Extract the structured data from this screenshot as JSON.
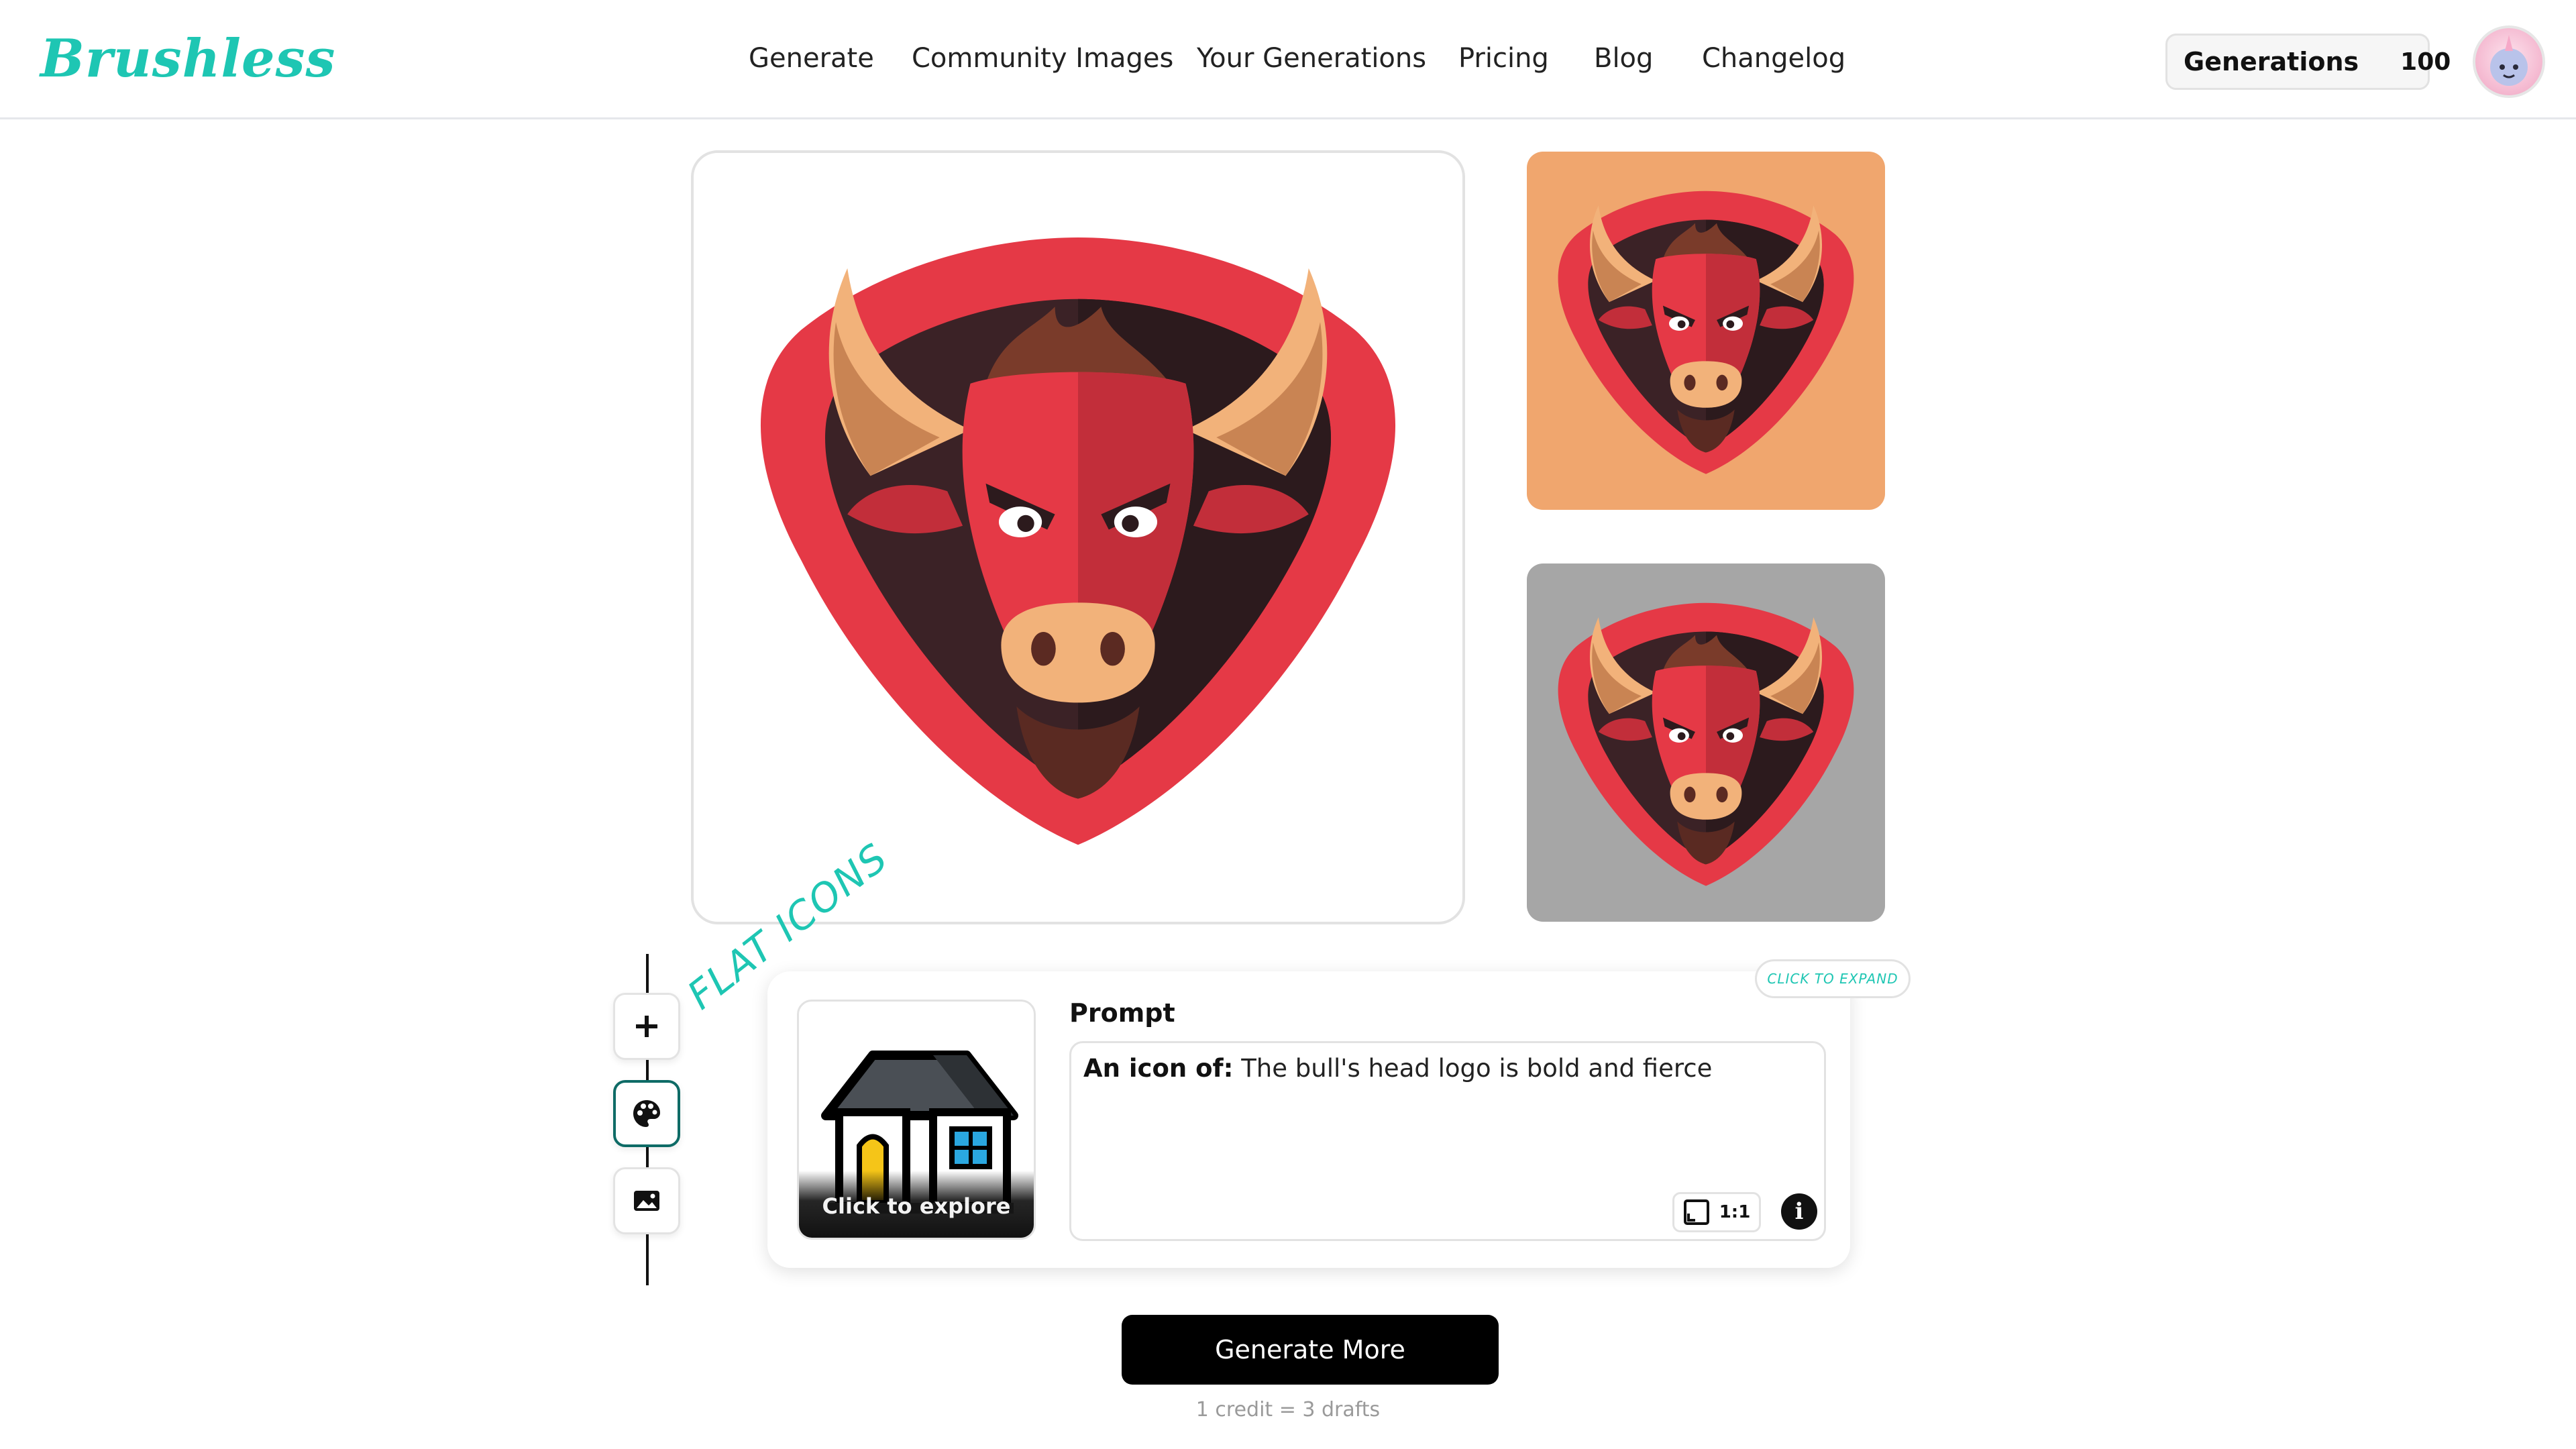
{
  "header": {
    "logo": "Brushless",
    "nav": [
      {
        "label": "Generate"
      },
      {
        "label": "Community Images"
      },
      {
        "label": "Your Generations"
      },
      {
        "label": "Pricing"
      },
      {
        "label": "Blog"
      },
      {
        "label": "Changelog"
      }
    ],
    "generations_label": "Generations",
    "generations_count": "100"
  },
  "results": {
    "main_image_icon": "bull-head-logo",
    "thumbnails": [
      {
        "icon": "bull-head-logo",
        "background": "#f0a66e"
      },
      {
        "icon": "bull-head-logo",
        "background": "#a6a6a6"
      }
    ]
  },
  "tools": [
    {
      "icon": "plus-icon"
    },
    {
      "icon": "palette-icon",
      "active": true
    },
    {
      "icon": "image-icon"
    }
  ],
  "style": {
    "name": "FLAT ICONS",
    "explore_caption": "Click to explore",
    "preview_icon": "house-icon"
  },
  "prompt": {
    "expand_label": "CLICK TO EXPAND",
    "label": "Prompt",
    "prefix": "An icon of:",
    "text": "The bull's head logo is bold and fierce",
    "aspect_ratio": "1:1"
  },
  "actions": {
    "generate_label": "Generate More",
    "credit_note": "1 credit = 3 drafts"
  },
  "colors": {
    "brand": "#1ec6b3",
    "primary_button": "#000000",
    "bull_red": "#e53946",
    "bull_dark": "#3b2226"
  }
}
